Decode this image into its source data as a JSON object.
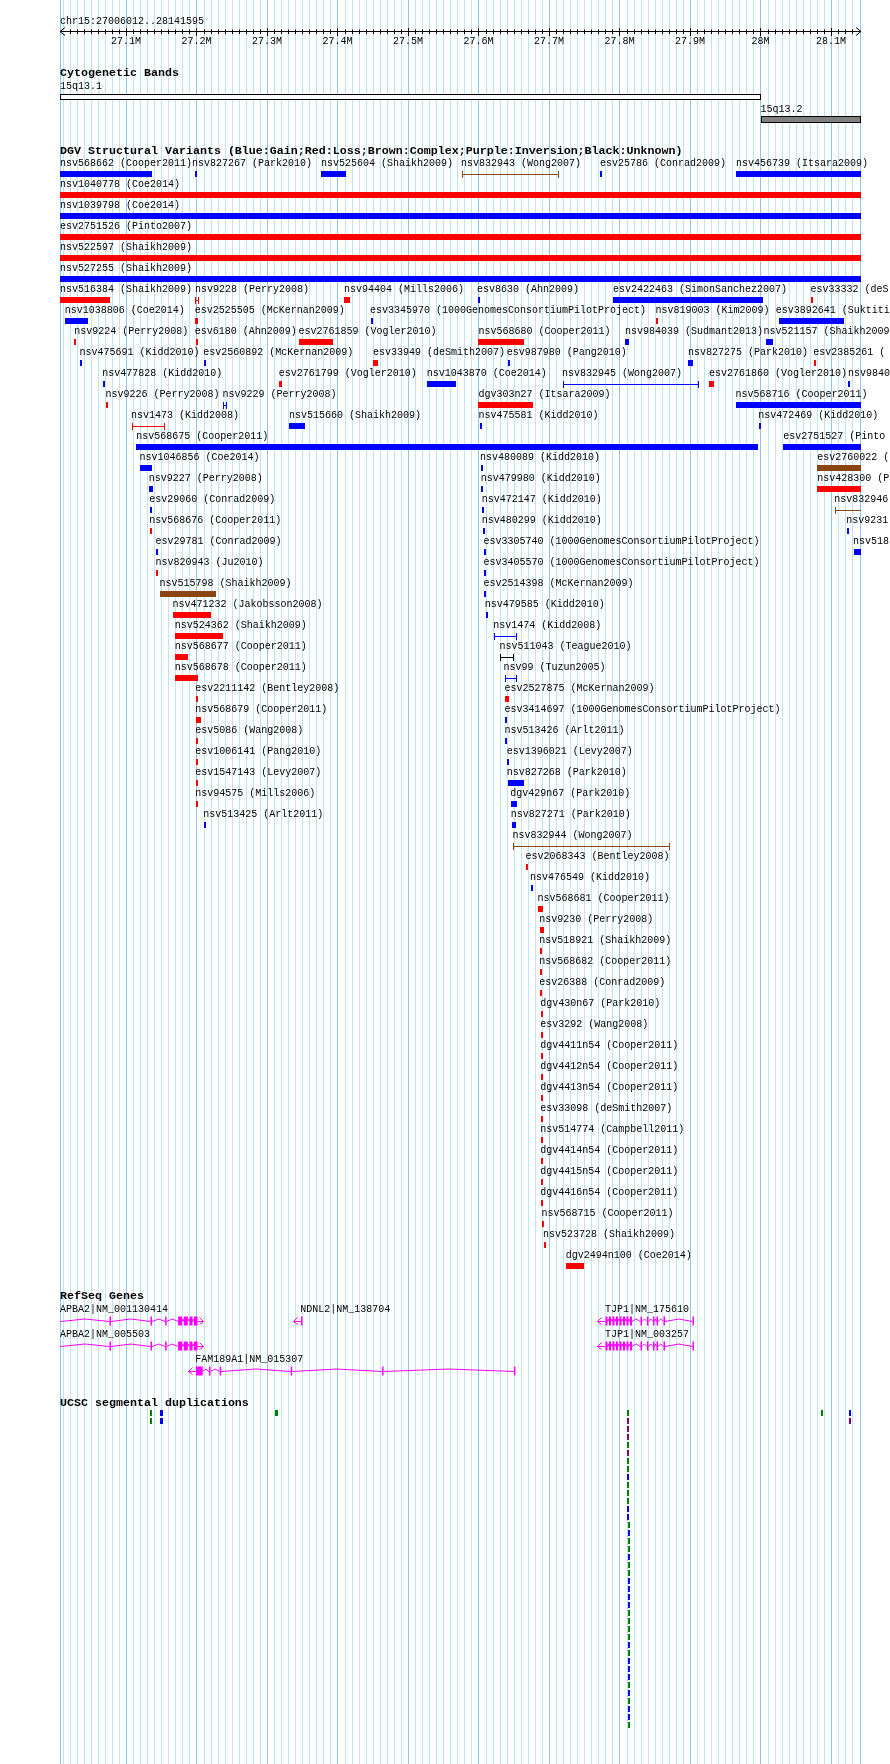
{
  "ruler": {
    "location": "chr15:27006012..28141595",
    "ticks": [
      "27.1M",
      "27.2M",
      "27.3M",
      "27.4M",
      "27.5M",
      "27.6M",
      "27.7M",
      "27.8M",
      "27.9M",
      "28M",
      "28.1M"
    ]
  },
  "cytogenetic_bands": {
    "title": "Cytogenetic Bands",
    "bands": [
      {
        "label": "15q13.1",
        "color": "#ffffff"
      },
      {
        "label": "15q13.2",
        "color": "#808080"
      }
    ]
  },
  "dgv_variants": {
    "title": "DGV Structural Variants (Blue:Gain;Red:Loss;Brown:Complex;Purple:Inversion;Black:Unknown)",
    "rows": [
      {
        "features": [
          {
            "label": "nsv568662 (Cooper2011)",
            "color": "#0000ff",
            "kind": "box"
          },
          {
            "label": "nsv827267 (Park2010)",
            "color": "#0000ff",
            "kind": "box"
          },
          {
            "label": "nsv525604 (Shaikh2009)",
            "color": "#0000ff",
            "kind": "box"
          },
          {
            "label": "nsv832943 (Wong2007)",
            "color": "#8b4513",
            "kind": "span"
          },
          {
            "label": "esv25786 (Conrad2009)",
            "color": "#0000ff",
            "kind": "box"
          },
          {
            "label": "nsv456739 (Itsara2009)",
            "color": "#0000ff",
            "kind": "box"
          }
        ]
      },
      {
        "features": [
          {
            "label": "nsv1040778 (Coe2014)",
            "color": "#ff0000",
            "kind": "box"
          }
        ]
      },
      {
        "features": [
          {
            "label": "nsv1039798 (Coe2014)",
            "color": "#0000ff",
            "kind": "box"
          }
        ]
      },
      {
        "features": [
          {
            "label": "esv2751526 (Pinto2007)",
            "color": "#ff0000",
            "kind": "box"
          }
        ]
      },
      {
        "features": [
          {
            "label": "nsv522597 (Shaikh2009)",
            "color": "#ff0000",
            "kind": "box"
          }
        ]
      },
      {
        "features": [
          {
            "label": "nsv527255 (Shaikh2009)",
            "color": "#0000ff",
            "kind": "box"
          }
        ]
      },
      {
        "features": [
          {
            "label": "nsv516384 (Shaikh2009)",
            "color": "#ff0000",
            "kind": "box"
          },
          {
            "label": "nsv9228 (Perry2008)",
            "color": "#ff0000",
            "kind": "span"
          },
          {
            "label": "nsv94404 (Mills2006)",
            "color": "#ff0000",
            "kind": "box"
          },
          {
            "label": "esv8630 (Ahn2009)",
            "color": "#0000ff",
            "kind": "box"
          },
          {
            "label": "esv2422463 (SimonSanchez2007)",
            "color": "#0000ff",
            "kind": "box"
          },
          {
            "label": "esv33332 (deS",
            "color": "#ff0000",
            "kind": "box"
          }
        ]
      },
      {
        "features": [
          {
            "label": "nsv1038806 (Coe2014)",
            "color": "#0000ff",
            "kind": "box"
          },
          {
            "label": "esv2525505 (McKernan2009)",
            "color": "#ff0000",
            "kind": "box"
          },
          {
            "label": "esv3345970 (1000GenomesConsortiumPilotProject)",
            "color": "#0000ff",
            "kind": "box"
          },
          {
            "label": "nsv819003 (Kim2009)",
            "color": "#ff0000",
            "kind": "box"
          },
          {
            "label": "esv3892641 (Suktiti",
            "color": "#0000ff",
            "kind": "box"
          }
        ]
      },
      {
        "features": [
          {
            "label": "nsv9224 (Perry2008)",
            "color": "#ff0000",
            "kind": "box"
          },
          {
            "label": "esv6180 (Ahn2009)",
            "color": "#ff0000",
            "kind": "box"
          },
          {
            "label": "esv2761859 (Vogler2010)",
            "color": "#ff0000",
            "kind": "box"
          },
          {
            "label": "nsv568680 (Cooper2011)",
            "color": "#ff0000",
            "kind": "box"
          },
          {
            "label": "nsv984039 (Sudmant2013)",
            "color": "#0000ff",
            "kind": "box"
          },
          {
            "label": "nsv521157 (Shaikh2009",
            "color": "#0000ff",
            "kind": "box"
          }
        ]
      },
      {
        "features": [
          {
            "label": "nsv475691 (Kidd2010)",
            "color": "#0000ff",
            "kind": "box"
          },
          {
            "label": "esv2560892 (McKernan2009)",
            "color": "#0000ff",
            "kind": "box"
          },
          {
            "label": "esv33949 (deSmith2007)",
            "color": "#ff0000",
            "kind": "box"
          },
          {
            "label": "esv987980 (Pang2010)",
            "color": "#0000ff",
            "kind": "box"
          },
          {
            "label": "nsv827275 (Park2010)",
            "color": "#0000ff",
            "kind": "box"
          },
          {
            "label": "esv2385261 (",
            "color": "#ff0000",
            "kind": "box"
          }
        ]
      },
      {
        "features": [
          {
            "label": "nsv477828 (Kidd2010)",
            "color": "#0000ff",
            "kind": "box"
          },
          {
            "label": "esv2761799 (Vogler2010)",
            "color": "#ff0000",
            "kind": "box"
          },
          {
            "label": "nsv1043870 (Coe2014)",
            "color": "#0000ff",
            "kind": "box"
          },
          {
            "label": "nsv832945 (Wong2007)",
            "color": "#0000ff",
            "kind": "span"
          },
          {
            "label": "esv2761860 (Vogler2010)",
            "color": "#ff0000",
            "kind": "box"
          },
          {
            "label": "nsv9840",
            "color": "#0000ff",
            "kind": "box"
          }
        ]
      },
      {
        "features": [
          {
            "label": "nsv9226 (Perry2008)",
            "color": "#ff0000",
            "kind": "box"
          },
          {
            "label": "nsv9229 (Perry2008)",
            "color": "#0000ff",
            "kind": "span"
          },
          {
            "label": "dgv303n27 (Itsara2009)",
            "color": "#ff0000",
            "kind": "box"
          },
          {
            "label": "nsv568716 (Cooper2011)",
            "color": "#0000ff",
            "kind": "box"
          }
        ]
      },
      {
        "features": [
          {
            "label": "nsv1473 (Kidd2008)",
            "color": "#ff0000",
            "kind": "span"
          },
          {
            "label": "nsv515660 (Shaikh2009)",
            "color": "#0000ff",
            "kind": "box"
          },
          {
            "label": "nsv475581 (Kidd2010)",
            "color": "#0000ff",
            "kind": "box"
          },
          {
            "label": "nsv472469 (Kidd2010)",
            "color": "#0000ff",
            "kind": "box"
          }
        ]
      },
      {
        "features": [
          {
            "label": "nsv568675 (Cooper2011)",
            "color": "#0000ff",
            "kind": "box"
          },
          {
            "label": "esv2751527 (Pinto",
            "color": "#0000ff",
            "kind": "box"
          }
        ]
      },
      {
        "features": [
          {
            "label": "nsv1046856 (Coe2014)",
            "color": "#0000ff",
            "kind": "box"
          },
          {
            "label": "nsv480089 (Kidd2010)",
            "color": "#0000ff",
            "kind": "box"
          },
          {
            "label": "esv2760022 (",
            "color": "#8b4513",
            "kind": "box"
          }
        ]
      },
      {
        "features": [
          {
            "label": "nsv9227 (Perry2008)",
            "color": "#0000ff",
            "kind": "box"
          },
          {
            "label": "nsv479980 (Kidd2010)",
            "color": "#0000ff",
            "kind": "box"
          },
          {
            "label": "nsv428300 (P",
            "color": "#ff0000",
            "kind": "box"
          }
        ]
      },
      {
        "features": [
          {
            "label": "esv29060 (Conrad2009)",
            "color": "#0000ff",
            "kind": "box"
          },
          {
            "label": "nsv472147 (Kidd2010)",
            "color": "#0000ff",
            "kind": "box"
          },
          {
            "label": "nsv832946",
            "color": "#8b4513",
            "kind": "span"
          }
        ]
      },
      {
        "features": [
          {
            "label": "nsv568676 (Cooper2011)",
            "color": "#ff0000",
            "kind": "box"
          },
          {
            "label": "nsv480299 (Kidd2010)",
            "color": "#0000ff",
            "kind": "box"
          },
          {
            "label": "nsv9231",
            "color": "#0000ff",
            "kind": "box"
          }
        ]
      },
      {
        "features": [
          {
            "label": "esv29781 (Conrad2009)",
            "color": "#0000ff",
            "kind": "box"
          },
          {
            "label": "esv3305740 (1000GenomesConsortiumPilotProject)",
            "color": "#0000ff",
            "kind": "box"
          },
          {
            "label": "nsv518",
            "color": "#0000ff",
            "kind": "box"
          }
        ]
      },
      {
        "features": [
          {
            "label": "nsv820943 (Ju2010)",
            "color": "#ff0000",
            "kind": "box"
          },
          {
            "label": "esv3405570 (1000GenomesConsortiumPilotProject)",
            "color": "#0000ff",
            "kind": "box"
          }
        ]
      },
      {
        "features": [
          {
            "label": "nsv515798 (Shaikh2009)",
            "color": "#8b4513",
            "kind": "box"
          },
          {
            "label": "esv2514398 (McKernan2009)",
            "color": "#0000ff",
            "kind": "box"
          }
        ]
      },
      {
        "features": [
          {
            "label": "nsv471232 (Jakobsson2008)",
            "color": "#ff0000",
            "kind": "box"
          },
          {
            "label": "nsv479585 (Kidd2010)",
            "color": "#0000ff",
            "kind": "box"
          }
        ]
      },
      {
        "features": [
          {
            "label": "nsv524362 (Shaikh2009)",
            "color": "#ff0000",
            "kind": "box"
          },
          {
            "label": "nsv1474 (Kidd2008)",
            "color": "#0000ff",
            "kind": "span"
          }
        ]
      },
      {
        "features": [
          {
            "label": "nsv568677 (Cooper2011)",
            "color": "#ff0000",
            "kind": "box"
          },
          {
            "label": "nsv511043 (Teague2010)",
            "color": "#000000",
            "kind": "span"
          }
        ]
      },
      {
        "features": [
          {
            "label": "nsv568678 (Cooper2011)",
            "color": "#ff0000",
            "kind": "box"
          },
          {
            "label": "nsv99 (Tuzun2005)",
            "color": "#0000ff",
            "kind": "span"
          }
        ]
      },
      {
        "features": [
          {
            "label": "esv2211142 (Bentley2008)",
            "color": "#ff0000",
            "kind": "box"
          },
          {
            "label": "esv2527875 (McKernan2009)",
            "color": "#ff0000",
            "kind": "box"
          }
        ]
      },
      {
        "features": [
          {
            "label": "nsv568679 (Cooper2011)",
            "color": "#ff0000",
            "kind": "box"
          },
          {
            "label": "esv3414697 (1000GenomesConsortiumPilotProject)",
            "color": "#0000ff",
            "kind": "box"
          }
        ]
      },
      {
        "features": [
          {
            "label": "esv5086 (Wang2008)",
            "color": "#ff0000",
            "kind": "box"
          },
          {
            "label": "nsv513426 (Arlt2011)",
            "color": "#0000ff",
            "kind": "box"
          }
        ]
      },
      {
        "features": [
          {
            "label": "esv1006141 (Pang2010)",
            "color": "#ff0000",
            "kind": "box"
          },
          {
            "label": "esv1396021 (Levy2007)",
            "color": "#0000ff",
            "kind": "box"
          }
        ]
      },
      {
        "features": [
          {
            "label": "esv1547143 (Levy2007)",
            "color": "#ff0000",
            "kind": "box"
          },
          {
            "label": "nsv827268 (Park2010)",
            "color": "#0000ff",
            "kind": "box"
          }
        ]
      },
      {
        "features": [
          {
            "label": "nsv94575 (Mills2006)",
            "color": "#ff0000",
            "kind": "box"
          },
          {
            "label": "dgv429n67 (Park2010)",
            "color": "#0000ff",
            "kind": "box"
          }
        ]
      },
      {
        "features": [
          {
            "label": "nsv513425 (Arlt2011)",
            "color": "#0000ff",
            "kind": "box"
          },
          {
            "label": "nsv827271 (Park2010)",
            "color": "#0000ff",
            "kind": "box"
          }
        ]
      },
      {
        "features": [
          {
            "label": "nsv832944 (Wong2007)",
            "color": "#8b4513",
            "kind": "span"
          }
        ]
      },
      {
        "features": [
          {
            "label": "esv2068343 (Bentley2008)",
            "color": "#ff0000",
            "kind": "box"
          }
        ]
      },
      {
        "features": [
          {
            "label": "nsv476549 (Kidd2010)",
            "color": "#0000ff",
            "kind": "box"
          }
        ]
      },
      {
        "features": [
          {
            "label": "nsv568681 (Cooper2011)",
            "color": "#ff0000",
            "kind": "box"
          }
        ]
      },
      {
        "features": [
          {
            "label": "nsv9230 (Perry2008)",
            "color": "#ff0000",
            "kind": "box"
          }
        ]
      },
      {
        "features": [
          {
            "label": "nsv518921 (Shaikh2009)",
            "color": "#ff0000",
            "kind": "box"
          }
        ]
      },
      {
        "features": [
          {
            "label": "nsv568682 (Cooper2011)",
            "color": "#ff0000",
            "kind": "box"
          }
        ]
      },
      {
        "features": [
          {
            "label": "esv26388 (Conrad2009)",
            "color": "#ff0000",
            "kind": "box"
          }
        ]
      },
      {
        "features": [
          {
            "label": "dgv430n67 (Park2010)",
            "color": "#ff0000",
            "kind": "box"
          }
        ]
      },
      {
        "features": [
          {
            "label": "esv3292 (Wang2008)",
            "color": "#ff0000",
            "kind": "box"
          }
        ]
      },
      {
        "features": [
          {
            "label": "dgv4411n54 (Cooper2011)",
            "color": "#ff0000",
            "kind": "box"
          }
        ]
      },
      {
        "features": [
          {
            "label": "dgv4412n54 (Cooper2011)",
            "color": "#ff0000",
            "kind": "box"
          }
        ]
      },
      {
        "features": [
          {
            "label": "dgv4413n54 (Cooper2011)",
            "color": "#ff0000",
            "kind": "box"
          }
        ]
      },
      {
        "features": [
          {
            "label": "esv33098 (deSmith2007)",
            "color": "#ff0000",
            "kind": "box"
          }
        ]
      },
      {
        "features": [
          {
            "label": "nsv514774 (Campbell2011)",
            "color": "#ff0000",
            "kind": "box"
          }
        ]
      },
      {
        "features": [
          {
            "label": "dgv4414n54 (Cooper2011)",
            "color": "#ff0000",
            "kind": "box"
          }
        ]
      },
      {
        "features": [
          {
            "label": "dgv4415n54 (Cooper2011)",
            "color": "#ff0000",
            "kind": "box"
          }
        ]
      },
      {
        "features": [
          {
            "label": "dgv4416n54 (Cooper2011)",
            "color": "#ff0000",
            "kind": "box"
          }
        ]
      },
      {
        "features": [
          {
            "label": "nsv568715 (Cooper2011)",
            "color": "#ff0000",
            "kind": "box"
          }
        ]
      },
      {
        "features": [
          {
            "label": "nsv523728 (Shaikh2009)",
            "color": "#ff0000",
            "kind": "box"
          }
        ]
      },
      {
        "features": [
          {
            "label": "dgv2494n100 (Coe2014)",
            "color": "#ff0000",
            "kind": "box"
          }
        ]
      }
    ]
  },
  "refseq_genes": {
    "title": "RefSeq Genes",
    "genes": [
      {
        "label": "APBA2|NM_001130414",
        "kind": "forward"
      },
      {
        "label": "NDNL2|NM_138704",
        "kind": "reverse"
      },
      {
        "label": "TJP1|NM_175610",
        "kind": "reverse"
      },
      {
        "label": "APBA2|NM_005503",
        "kind": "forward"
      },
      {
        "label": "TJP1|NM_003257",
        "kind": "reverse"
      },
      {
        "label": "FAM189A1|NM_015307",
        "kind": "reverse"
      }
    ]
  },
  "segmental_duplications": {
    "title": "UCSC segmental duplications",
    "features": [
      {
        "color": "#008000"
      },
      {
        "color": "#0000ff"
      },
      {
        "color": "#008000"
      },
      {
        "color": "#008000"
      },
      {
        "color": "#008000"
      },
      {
        "color": "#0000ff"
      },
      {
        "color": "#008000"
      },
      {
        "color": "#0000ff"
      },
      {
        "color": "#800080"
      },
      {
        "color": "#800080"
      },
      {
        "color": "#800080"
      },
      {
        "color": "#800080"
      },
      {
        "color": "#008000"
      },
      {
        "color": "#800080"
      },
      {
        "color": "#008000"
      },
      {
        "color": "#008000"
      },
      {
        "color": "#0000ff"
      },
      {
        "color": "#008000"
      },
      {
        "color": "#008000"
      },
      {
        "color": "#008000"
      },
      {
        "color": "#0000ff"
      },
      {
        "color": "#0000ff"
      },
      {
        "color": "#008000"
      },
      {
        "color": "#0000ff"
      },
      {
        "color": "#008000"
      },
      {
        "color": "#008000"
      },
      {
        "color": "#0000ff"
      },
      {
        "color": "#008000"
      },
      {
        "color": "#008000"
      },
      {
        "color": "#0000ff"
      },
      {
        "color": "#0000ff"
      },
      {
        "color": "#0000ff"
      },
      {
        "color": "#0000ff"
      },
      {
        "color": "#008000"
      },
      {
        "color": "#008000"
      },
      {
        "color": "#008000"
      },
      {
        "color": "#008000"
      },
      {
        "color": "#0000ff"
      },
      {
        "color": "#008000"
      },
      {
        "color": "#0000ff"
      },
      {
        "color": "#0000ff"
      },
      {
        "color": "#0000ff"
      },
      {
        "color": "#008000"
      },
      {
        "color": "#0000ff"
      },
      {
        "color": "#008000"
      },
      {
        "color": "#0000ff"
      },
      {
        "color": "#0000ff"
      },
      {
        "color": "#008000"
      }
    ]
  }
}
